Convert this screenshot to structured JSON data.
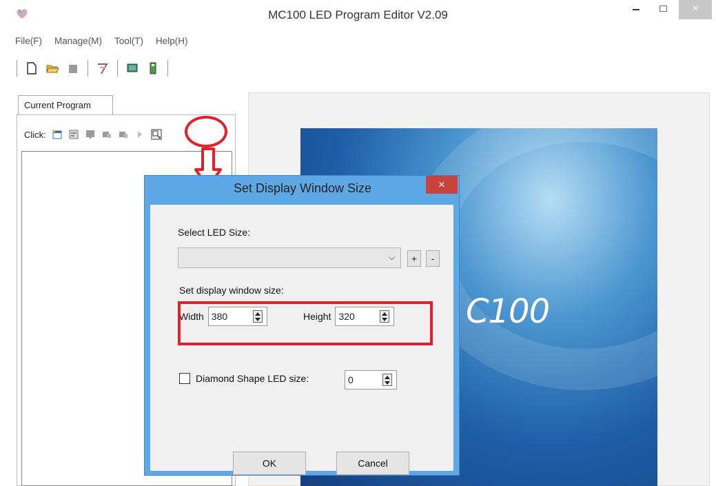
{
  "window": {
    "title": "MC100 LED Program Editor V2.09",
    "close_glyph": "×"
  },
  "menu": {
    "items": [
      "File(F)",
      "Manage(M)",
      "Tool(T)",
      "Help(H)"
    ]
  },
  "toolbar_icons": [
    "new-file-icon",
    "open-folder-icon",
    "stop-icon",
    "wand-icon",
    "display-icon",
    "usb-icon"
  ],
  "left_panel": {
    "tab_label": "Current Program",
    "click_label": "Click:",
    "icons": [
      "add-program-icon",
      "add-area-icon",
      "area-icon",
      "move-up-icon",
      "move-down-icon",
      "play-icon",
      "display-size-icon"
    ]
  },
  "preview": {
    "text": "C100"
  },
  "dialog": {
    "title": "Set Display Window Size",
    "close_glyph": "×",
    "select_led_label": "Select LED Size:",
    "select_led_value": "",
    "plus_label": "+",
    "minus_label": "-",
    "set_size_label": "Set display window size:",
    "width_label": "Width",
    "width_value": "380",
    "height_label": "Height",
    "height_value": "320",
    "diamond_label": "Diamond Shape LED size:",
    "diamond_checked": false,
    "diamond_value": "0",
    "ok_label": "OK",
    "cancel_label": "Cancel"
  },
  "colors": {
    "annotation": "#e0202a",
    "dialog_frame": "#5fa8e6",
    "close_button": "#c9433a"
  }
}
